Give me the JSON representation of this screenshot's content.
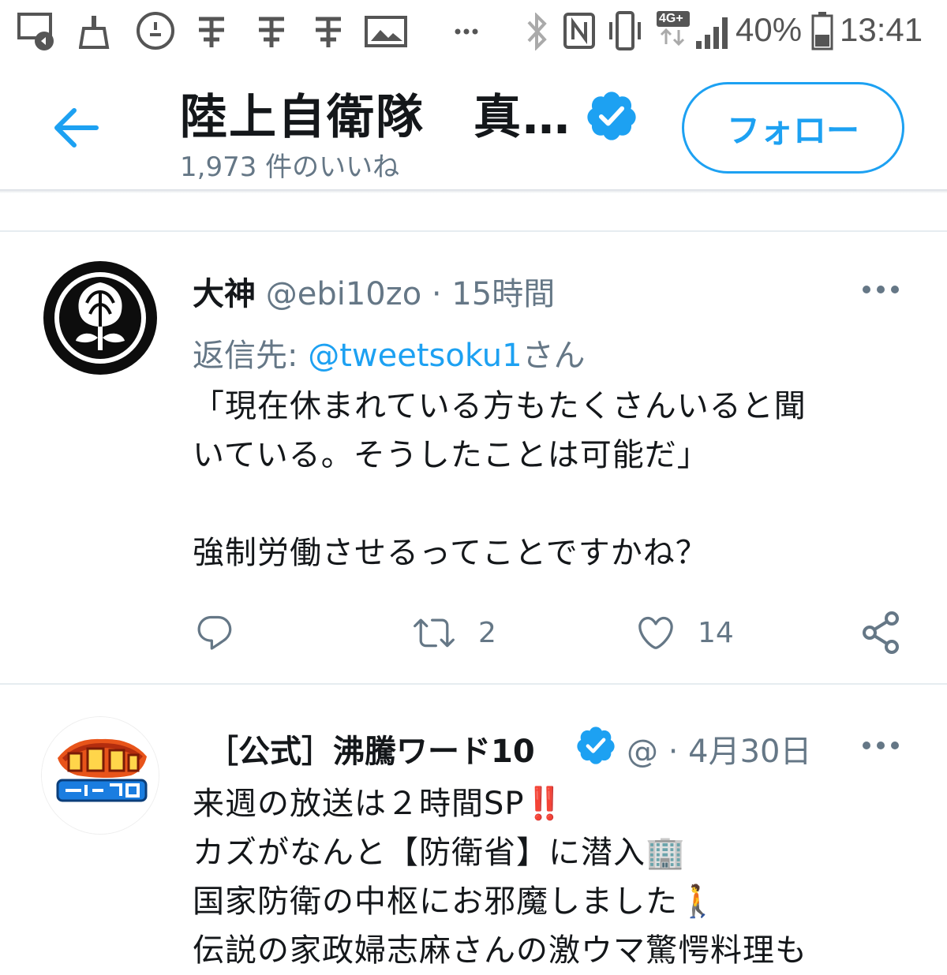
{
  "status_bar": {
    "battery": "40%",
    "time": "13:41",
    "network": "4G+",
    "icons": [
      "screenshot-icon",
      "sweep-icon",
      "broom-circle-icon",
      "app-icon",
      "app-icon",
      "app-icon",
      "gallery-icon",
      "more-dots-icon",
      "bluetooth-icon",
      "nfc-icon",
      "vibrate-icon",
      "network-4g-icon",
      "signal-icon",
      "battery-icon"
    ]
  },
  "header": {
    "title": "陸上自衛隊　真…",
    "subtitle": "1,973 件のいいね",
    "follow_label": "フォロー"
  },
  "tweets": [
    {
      "name": "大神",
      "handle": "@ebi10zo",
      "separator": "·",
      "time": "15時間",
      "reply_label": "返信先: ",
      "reply_mention": "@tweetsoku1",
      "reply_suffix": "さん",
      "text": "「現在休まれている方もたくさんいると聞\nいている。そうしたことは可能だ」\n\n強制労働させるってことですかね？",
      "retweets": "2",
      "likes": "14"
    },
    {
      "name": "［公式］沸騰ワード10",
      "handle": "@",
      "separator": "·",
      "time": "4月30日",
      "text": "来週の放送は２時間SP‼️\nカズがなんと【防衛省】に潜入🏢\n国家防衛の中枢にお邪魔しました🚶\n伝説の家政婦志麻さんの激ウマ驚愕料理も"
    }
  ],
  "colors": {
    "accent": "#1da1f2",
    "secondary_text": "#657786",
    "primary_text": "#14171a"
  }
}
